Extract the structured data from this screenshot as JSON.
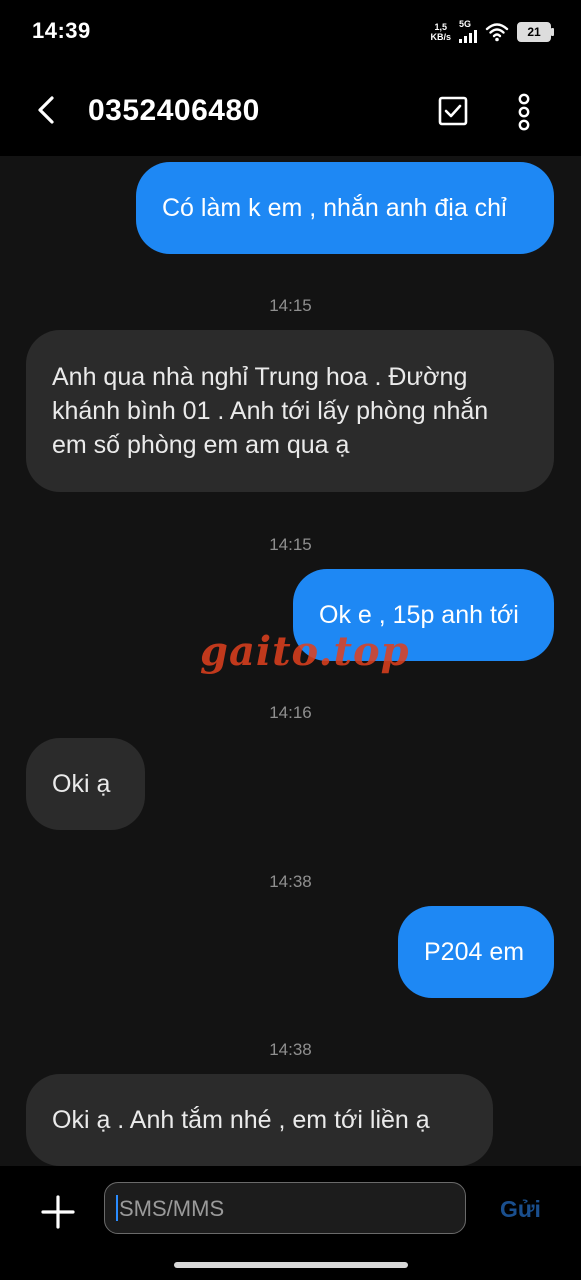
{
  "status_bar": {
    "time": "14:39",
    "net_speed_value": "1,5",
    "net_speed_unit": "KB/s",
    "network_type": "5G",
    "battery": "21"
  },
  "header": {
    "title": "0352406480",
    "icons": [
      "back-arrow-icon",
      "select-checkbox-icon",
      "more-vertical-icon"
    ]
  },
  "messages": [
    {
      "type": "sent",
      "text": "Có làm k em , nhắn anh địa chỉ"
    },
    {
      "type": "timestamp",
      "text": "14:15"
    },
    {
      "type": "received",
      "text": "Anh qua nhà nghỉ Trung hoa . Đường khánh bình 01 . Anh tới lấy phòng nhắn em số phòng em am qua ạ"
    },
    {
      "type": "timestamp",
      "text": "14:15"
    },
    {
      "type": "sent",
      "text": "Ok e , 15p anh tới"
    },
    {
      "type": "timestamp",
      "text": "14:16"
    },
    {
      "type": "received",
      "text": "Oki ạ"
    },
    {
      "type": "timestamp",
      "text": "14:38"
    },
    {
      "type": "sent",
      "text": "P204 em"
    },
    {
      "type": "timestamp",
      "text": "14:38"
    },
    {
      "type": "received",
      "text": "Oki ạ . Anh tắm nhé , em tới liền ạ"
    }
  ],
  "watermark": "gaito.top",
  "composer": {
    "placeholder": "SMS/MMS",
    "value": "",
    "send_label": "Gửi"
  },
  "colors": {
    "sent_bubble": "#1e88f4",
    "received_bubble": "#2b2b2b",
    "background": "#131313",
    "send_label": "#1a4f8e"
  }
}
